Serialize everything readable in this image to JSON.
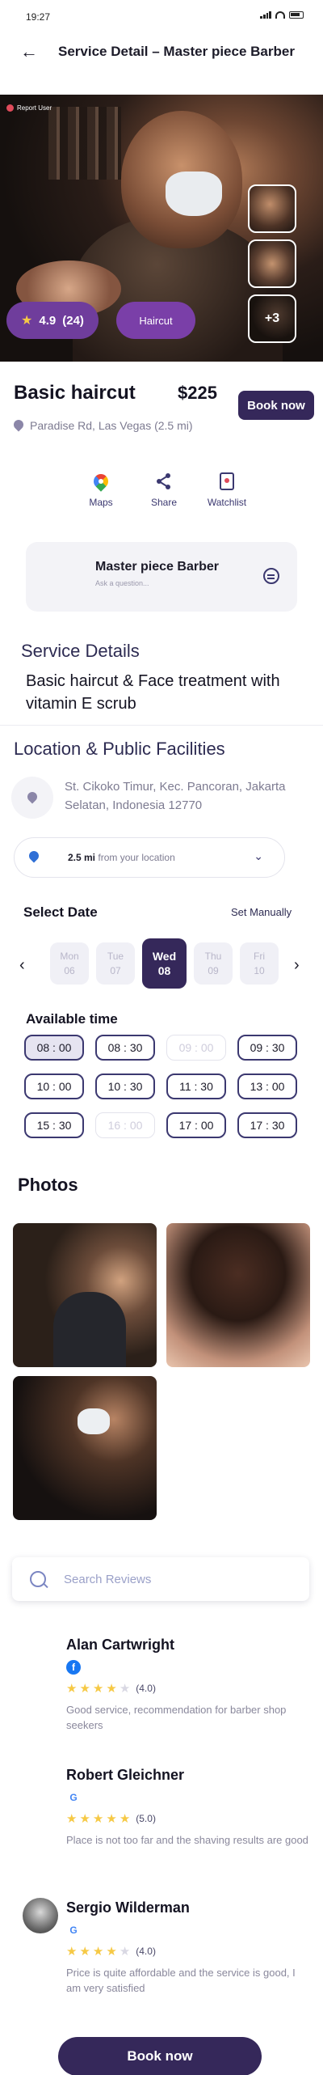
{
  "status_bar": {
    "time": "19:27"
  },
  "header": {
    "title": "Service Detail – Master piece Barber"
  },
  "hero": {
    "report_label": "Report User",
    "rating": "4.9",
    "review_count": "(24)",
    "category": "Haircut",
    "more_photos": "+3"
  },
  "service": {
    "name": "Basic haircut",
    "price": "$225",
    "book_label": "Book now",
    "address": "Paradise Rd, Las Vegas (2.5 mi)"
  },
  "actions": [
    {
      "label": "Maps",
      "icon": "maps-pin-icon"
    },
    {
      "label": "Share",
      "icon": "share-icon"
    },
    {
      "label": "Watchlist",
      "icon": "watchlist-icon"
    }
  ],
  "barber": {
    "name": "Master piece Barber",
    "ask": "Ask a question..."
  },
  "service_details": {
    "title": "Service Details",
    "text": "Basic haircut & Face treatment with vitamin E scrub"
  },
  "location": {
    "title": "Location & Public Facilities",
    "address": "St. Cikoko Timur, Kec. Pancoran, Jakarta Selatan, Indonesia 12770",
    "distance": "2.5 mi",
    "distance_suffix": " from your location"
  },
  "date": {
    "title": "Select Date",
    "set_manually": "Set Manually",
    "days": [
      {
        "dow": "Mon",
        "num": "06"
      },
      {
        "dow": "Tue",
        "num": "07"
      },
      {
        "dow": "Wed",
        "num": "08"
      },
      {
        "dow": "Thu",
        "num": "09"
      },
      {
        "dow": "Fri",
        "num": "10"
      }
    ],
    "selected": "08"
  },
  "time": {
    "title": "Available time",
    "slots": [
      "08 : 00",
      "08 : 30",
      "09 : 00",
      "09 : 30",
      "10 : 00",
      "10 : 30",
      "11 : 30",
      "13 : 00",
      "15 : 30",
      "16 : 00",
      "17 : 00",
      "17 : 30"
    ]
  },
  "photos": {
    "title": "Photos"
  },
  "reviews": {
    "search_placeholder": "Search Reviews",
    "items": [
      {
        "name": "Alan Cartwright",
        "source": "facebook",
        "rating": 4,
        "rating_text": "(4.0)",
        "text": "Good service, recommendation for barber shop seekers"
      },
      {
        "name": "Robert Gleichner",
        "source": "google",
        "rating": 5,
        "rating_text": "(5.0)",
        "text": "Place is not too far and the shaving results are good"
      },
      {
        "name": "Sergio Wilderman",
        "source": "google",
        "rating": 4,
        "rating_text": "(4.0)",
        "text": "Price is quite affordable and the service is good, I am very satisfied"
      }
    ]
  },
  "footer": {
    "book_label": "Book now"
  },
  "colors": {
    "primary": "#35285a",
    "accent": "#6f3d9c",
    "star": "#f6c945"
  }
}
